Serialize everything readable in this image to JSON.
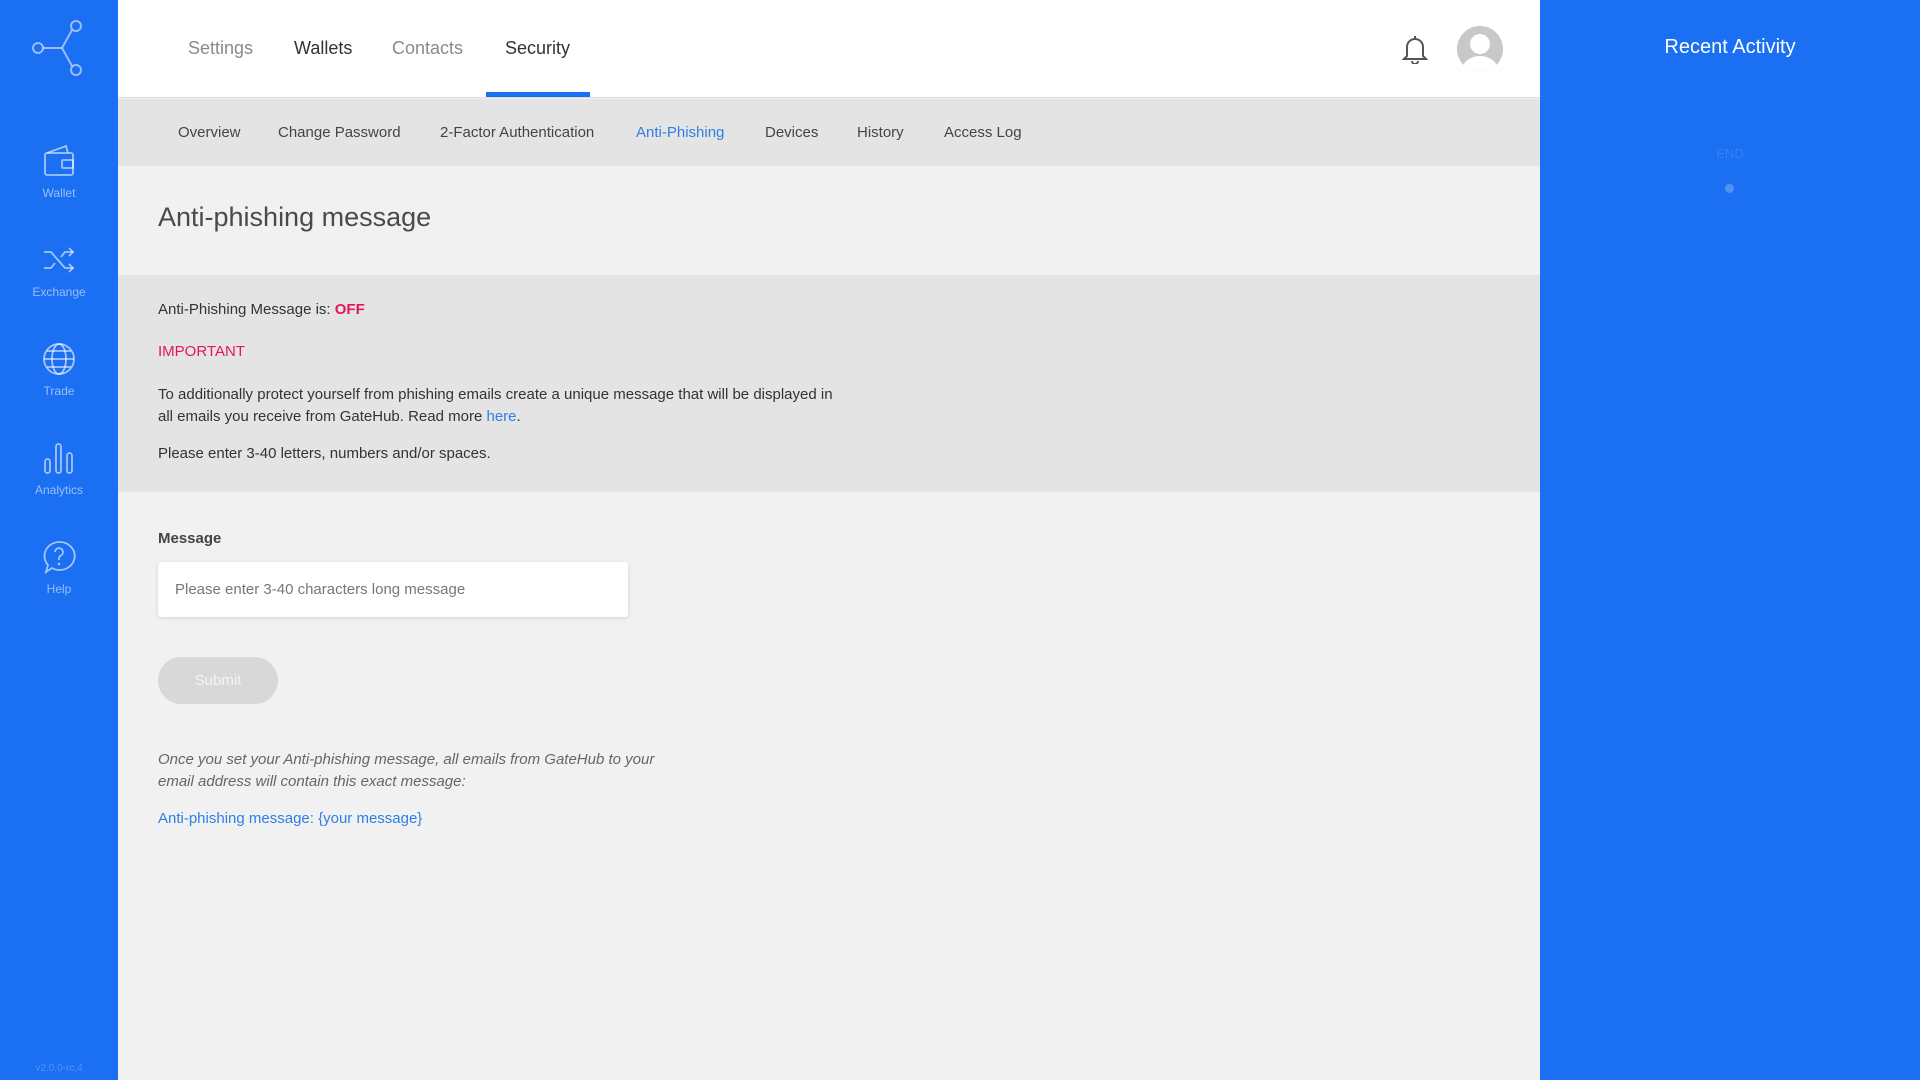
{
  "sidebar": {
    "items": [
      {
        "label": "Wallet",
        "icon": "wallet-icon"
      },
      {
        "label": "Exchange",
        "icon": "shuffle-icon"
      },
      {
        "label": "Trade",
        "icon": "globe-icon"
      },
      {
        "label": "Analytics",
        "icon": "bar-chart-icon"
      },
      {
        "label": "Help",
        "icon": "help-bubble-icon"
      }
    ],
    "version": "v2.0.0-rc.4"
  },
  "topbar": {
    "tabs": [
      {
        "label": "Settings"
      },
      {
        "label": "Wallets"
      },
      {
        "label": "Contacts"
      },
      {
        "label": "Security"
      }
    ],
    "active_tab": "Security"
  },
  "subnav": {
    "tabs": [
      {
        "label": "Overview"
      },
      {
        "label": "Change Password"
      },
      {
        "label": "2-Factor Authentication"
      },
      {
        "label": "Anti-Phishing"
      },
      {
        "label": "Devices"
      },
      {
        "label": "History"
      },
      {
        "label": "Access Log"
      }
    ],
    "active_tab": "Anti-Phishing"
  },
  "main": {
    "title": "Anti-phishing message",
    "status_prefix": "Anti-Phishing Message is: ",
    "status_value": "OFF",
    "important": "IMPORTANT",
    "info_text": "To additionally protect yourself from phishing emails create a unique message that will be displayed in all emails you receive from GateHub. Read more ",
    "info_link": "here",
    "info_suffix": ".",
    "rule": "Please enter 3-40 letters, numbers and/or spaces.",
    "field_label": "Message",
    "input_value": "",
    "input_placeholder": "Please enter 3-40 characters long message",
    "submit_label": "Submit",
    "note": "Once you set your Anti-phishing message, all emails from GateHub to your email address will contain this exact message:",
    "example": "Anti-phishing message: {your message}"
  },
  "right_panel": {
    "title": "Recent Activity",
    "end_label": "END"
  },
  "colors": {
    "brand_blue": "#1a6ff2",
    "link_blue": "#2f7fe6",
    "alert_pink": "#e3165b"
  }
}
